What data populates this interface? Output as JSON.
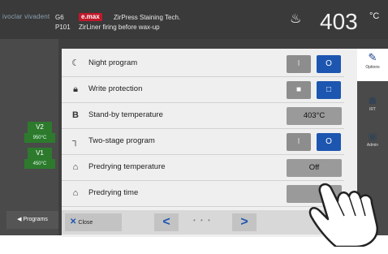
{
  "header": {
    "logo_text": "ivoclar vivadent",
    "program_code_1": "G6",
    "program_code_2": "P101",
    "brand": "e.max",
    "title_line1": "ZirPress Staining Tech.",
    "title_line2": "ZirLiner firing before wax-up",
    "temperature": "403",
    "temperature_unit": "°C"
  },
  "left_panel": {
    "v2_label": "V2",
    "v2_temp": "950°C",
    "v1_label": "V1",
    "v1_temp": "450°C",
    "programs_label": "Programs"
  },
  "right_tabs": {
    "options_label": "Options",
    "tab2_label": "IRT",
    "tab3_label": "Admin"
  },
  "settings": [
    {
      "label": "Night program",
      "icon": "moon-icon",
      "control": "toggle",
      "on_label": "I",
      "off_label": "O",
      "state": "off"
    },
    {
      "label": "Write protection",
      "icon": "lock-icon",
      "control": "lock-toggle",
      "state": "unlocked"
    },
    {
      "label": "Stand-by temperature",
      "icon": "B",
      "control": "value",
      "value": "403°C"
    },
    {
      "label": "Two-stage program",
      "icon": "two-stage-icon",
      "control": "toggle",
      "on_label": "I",
      "off_label": "O",
      "state": "off"
    },
    {
      "label": "Predrying temperature",
      "icon": "predrying-icon",
      "control": "value",
      "value": "Off"
    },
    {
      "label": "Predrying time",
      "icon": "predrying-icon",
      "control": "value",
      "value": ""
    }
  ],
  "footer": {
    "close_label": "Close",
    "prev_label": "<",
    "next_label": ">",
    "page_dots": "• • •"
  },
  "colors": {
    "accent_blue": "#1d56b0",
    "standby_green": "#2d7a2d",
    "brand_red": "#c0192b"
  }
}
